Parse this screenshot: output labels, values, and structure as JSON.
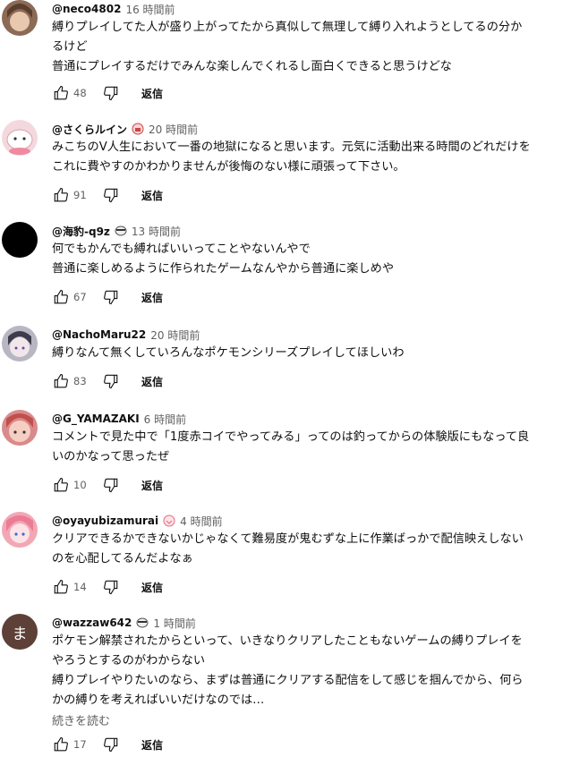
{
  "comments": [
    {
      "author": "@neco4802",
      "time": "16 時間前",
      "lines": [
        "縛りプレイしてた人が盛り上がってたから真似して無理して縛り入れようとしてるの分か",
        "るけど",
        "普通にプレイするだけでみんな楽しんでくれるし面白くできると思うけどな"
      ],
      "likes": "48",
      "reply": "返信",
      "avatar_color": "#8c6a55"
    },
    {
      "author": "@さくらルイン",
      "time": "20 時間前",
      "lines": [
        "みこちのV人生において一番の地獄になると思います。元気に活動出来る時間のどれだけを",
        "これに費やすのかわかりませんが後悔のない様に頑張って下さい。"
      ],
      "likes": "91",
      "reply": "返信",
      "avatar_color": "#f3d9de"
    },
    {
      "author": "@海豹-q9z",
      "time": "13 時間前",
      "lines": [
        "何でもかんでも縛ればいいってことやないんやで",
        "普通に楽しめるように作られたゲームなんやから普通に楽しめや"
      ],
      "likes": "67",
      "reply": "返信",
      "avatar_color": "#000000"
    },
    {
      "author": "@NachoMaru22",
      "time": "20 時間前",
      "lines": [
        "縛りなんて無くしていろんなポケモンシリーズプレイしてほしいわ"
      ],
      "likes": "83",
      "reply": "返信",
      "avatar_color": "#b9b6c4"
    },
    {
      "author": "@G_YAMAZAKI",
      "time": "6 時間前",
      "lines": [
        "コメントで見た中で「1度赤コイでやってみる」ってのは釣ってからの体験版にもなって良",
        "いのかなって思ったぜ"
      ],
      "likes": "10",
      "reply": "返信",
      "avatar_color": "#d98a8a"
    },
    {
      "author": "@oyayubizamurai",
      "time": "4 時間前",
      "lines": [
        "クリアできるかできないかじゃなくて難易度が鬼むずな上に作業ばっかで配信映えしない",
        "のを心配してるんだよなぁ"
      ],
      "likes": "14",
      "reply": "返信",
      "avatar_color": "#f2a7b5"
    },
    {
      "author": "@wazzaw642",
      "time": "1 時間前",
      "lines": [
        "ポケモン解禁されたからといって、いきなりクリアしたこともないゲームの縛りプレイを",
        "やろうとするのがわからない",
        "縛りプレイやりたいのなら、まずは普通にクリアする配信をして感じを掴んでから、何ら",
        "かの縛りを考えればいいだけなのでは…"
      ],
      "likes": "17",
      "reply": "返信",
      "avatar_color": "#5d4037",
      "avatar_letter": "ま",
      "read_more": "続きを読む"
    }
  ]
}
